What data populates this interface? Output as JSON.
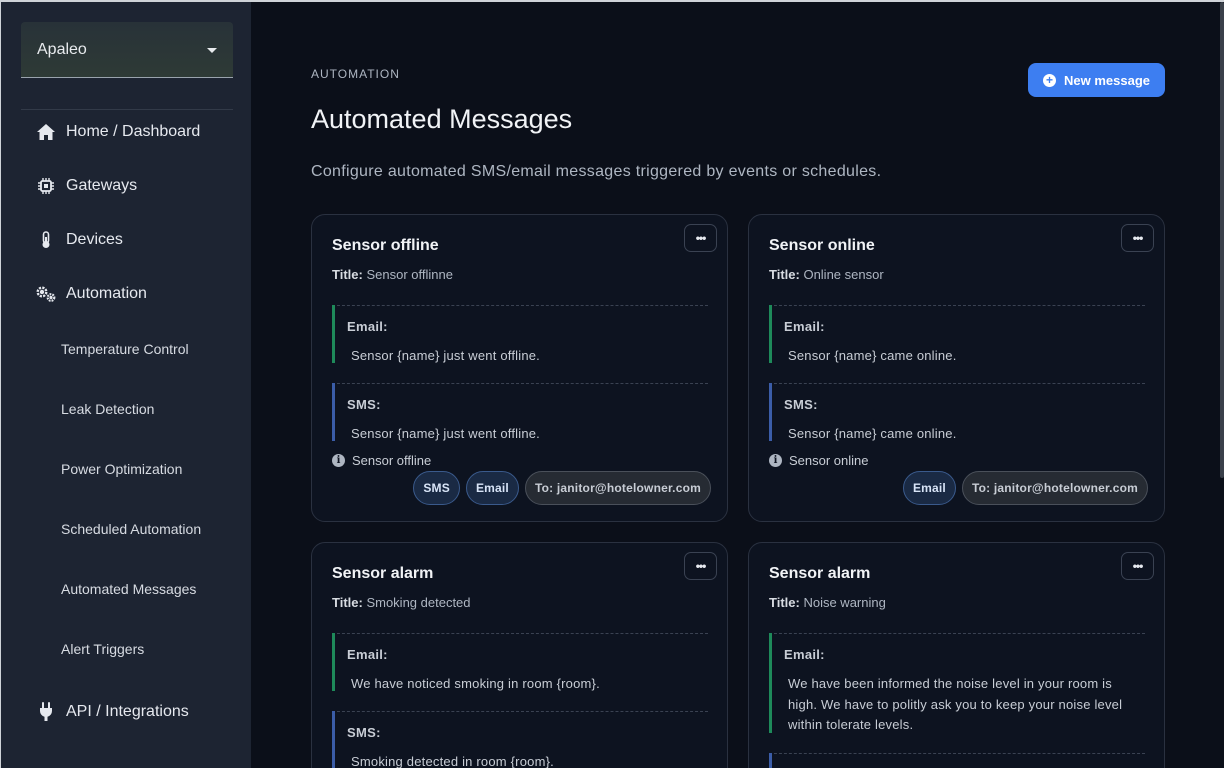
{
  "sidebar": {
    "org": "Apaleo",
    "nav": [
      {
        "label": "Home / Dashboard",
        "icon": "home-icon"
      },
      {
        "label": "Gateways",
        "icon": "chip-icon"
      },
      {
        "label": "Devices",
        "icon": "thermometer-icon"
      },
      {
        "label": "Automation",
        "icon": "gears-icon"
      },
      {
        "label": "API / Integrations",
        "icon": "plug-icon"
      }
    ],
    "sub": [
      "Temperature Control",
      "Leak Detection",
      "Power Optimization",
      "Scheduled Automation",
      "Automated Messages",
      "Alert Triggers"
    ]
  },
  "header": {
    "crumb": "AUTOMATION",
    "title": "Automated Messages",
    "description": "Configure automated SMS/email messages triggered by events or schedules.",
    "new_button": "New message"
  },
  "labels": {
    "title": "Title:",
    "email": "Email:",
    "sms": "SMS:"
  },
  "cards": [
    {
      "name": "Sensor offline",
      "title": "Sensor offlinne",
      "email": "Sensor {name} just went offline.",
      "sms": "Sensor {name} just went offline.",
      "trigger": "Sensor offline",
      "chips": [
        "SMS",
        "Email"
      ],
      "to": "To: janitor@hotelowner.com"
    },
    {
      "name": "Sensor online",
      "title": "Online sensor",
      "email": "Sensor {name} came online.",
      "sms": "Sensor {name} came online.",
      "trigger": "Sensor online",
      "chips": [
        "Email"
      ],
      "to": "To: janitor@hotelowner.com"
    },
    {
      "name": "Sensor alarm",
      "title": "Smoking detected",
      "email": "We have noticed smoking in room {room}.",
      "sms": "Smoking detected in room {room}."
    },
    {
      "name": "Sensor alarm",
      "title": "Noise warning",
      "email": "We have been informed the noise level in your room is high. We have to politly ask you to keep your noise level within tolerate levels."
    }
  ]
}
